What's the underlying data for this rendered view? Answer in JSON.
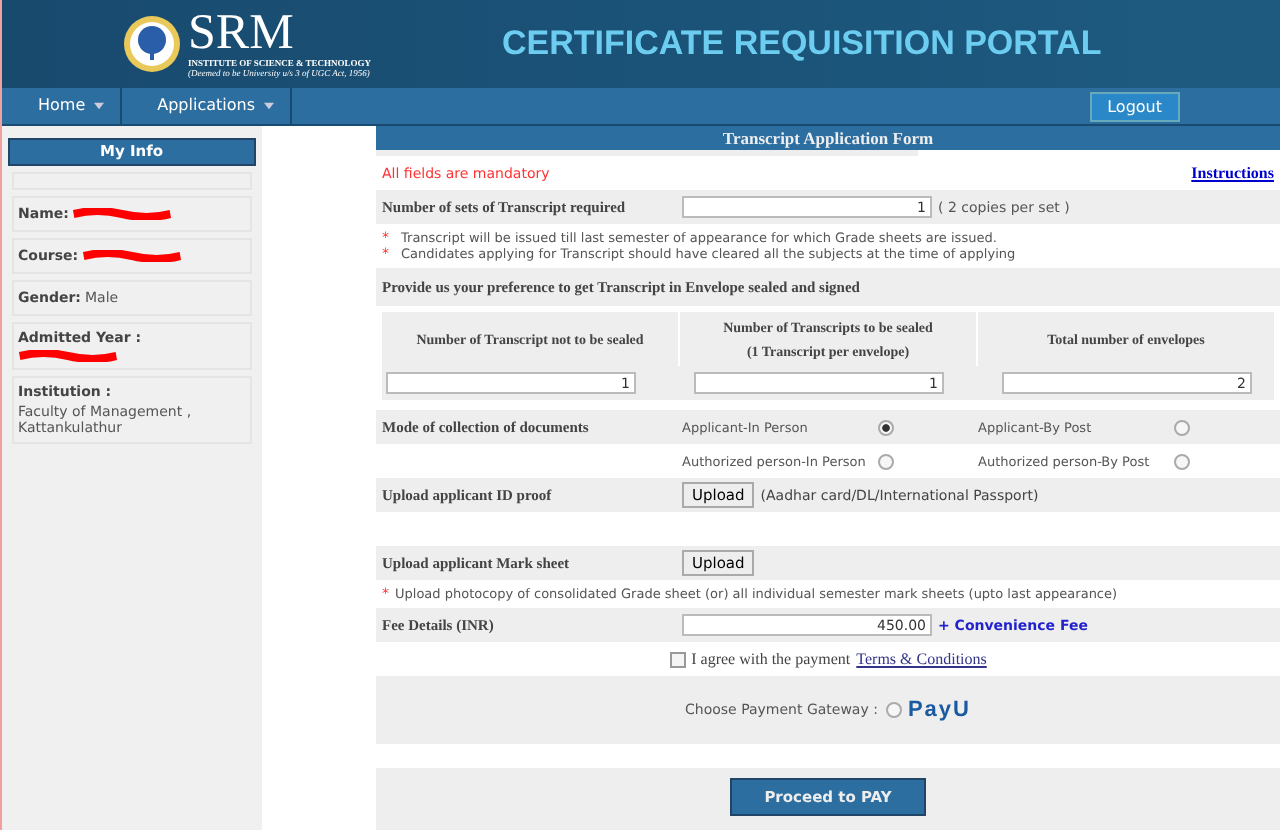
{
  "header": {
    "logo_name": "SRM",
    "logo_subtitle": "INSTITUTE OF SCIENCE & TECHNOLOGY",
    "logo_note": "(Deemed to be University u/s 3 of UGC Act, 1956)",
    "title": "CERTIFICATE REQUISITION PORTAL"
  },
  "nav": {
    "menus": [
      {
        "label": "Home"
      },
      {
        "label": "Applications"
      }
    ],
    "logout": "Logout"
  },
  "my_info": {
    "title": "My Info",
    "fields": [
      {
        "label": "Name:",
        "redacted": true
      },
      {
        "label": "Course:",
        "redacted": true
      },
      {
        "label": "Gender:",
        "value": "Male",
        "redacted": false
      },
      {
        "label": "Admitted Year :",
        "redacted": true
      },
      {
        "label": "Institution :",
        "value": "Faculty of Management , Kattankulathur",
        "redacted": false
      }
    ]
  },
  "form": {
    "title": "Transcript Application Form",
    "mandatory_note": "All fields are mandatory",
    "instructions_link": "Instructions",
    "sets": {
      "label": "Number of sets of Transcript required",
      "value": "1",
      "hint": "( 2 copies per set )"
    },
    "note_marker": "*",
    "notes": [
      "Transcript will be issued till last semester of appearance for which Grade sheets are issued.",
      "Candidates applying for Transcript should have cleared all the subjects at the time of applying"
    ],
    "preference_heading": "Provide us your preference to get Transcript in Envelope sealed and signed",
    "envelope_table": {
      "columns": [
        {
          "lines": [
            "Number of Transcript not to be sealed"
          ],
          "value": "1"
        },
        {
          "lines": [
            "Number of Transcripts to be sealed",
            "(1 Transcript per envelope)"
          ],
          "value": "1"
        },
        {
          "lines": [
            "Total number of envelopes"
          ],
          "value": "2"
        }
      ]
    },
    "collection": {
      "label": "Mode of collection of documents",
      "options": [
        {
          "label": "Applicant-In Person",
          "selected": true
        },
        {
          "label": "Applicant-By Post",
          "selected": false
        },
        {
          "label": "Authorized person-In Person",
          "selected": false
        },
        {
          "label": "Authorized person-By Post",
          "selected": false
        }
      ]
    },
    "id_proof": {
      "label": "Upload applicant ID proof",
      "button": "Upload",
      "hint": "(Aadhar card/DL/International Passport)"
    },
    "mark_sheet": {
      "label": "Upload applicant Mark sheet",
      "button": "Upload",
      "note": "Upload photocopy of consolidated Grade sheet (or) all individual semester mark sheets (upto last appearance)"
    },
    "fee": {
      "label": "Fee Details (INR)",
      "value": "450.00",
      "extra": "+ Convenience Fee"
    },
    "agree": {
      "checked": false,
      "text": "I agree with the payment",
      "link": "Terms & Conditions"
    },
    "gateway": {
      "label": "Choose Payment Gateway :",
      "selected": false,
      "logo": "PayU"
    },
    "submit": "Proceed to PAY"
  }
}
